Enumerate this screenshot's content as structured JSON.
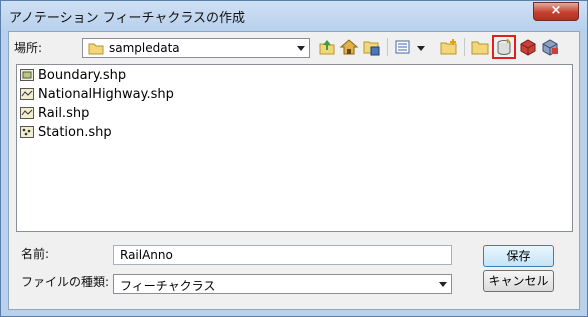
{
  "window": {
    "title": "アノテーション フィーチャクラスの作成",
    "close": "×"
  },
  "location": {
    "label": "場所:",
    "value": "sampledata"
  },
  "toolbar": {
    "icons": [
      "up-folder-icon",
      "home-folder-icon",
      "connect-folder-icon",
      "view-options-icon",
      "new-folder-icon",
      "folder-icon",
      "new-file-geodatabase-icon",
      "new-personal-geodatabase-icon",
      "new-feature-dataset-icon"
    ],
    "highlight_color": "#e0201c"
  },
  "files": [
    {
      "name": "Boundary.shp",
      "icon": "polygon-shapefile-icon"
    },
    {
      "name": "NationalHighway.shp",
      "icon": "line-shapefile-icon"
    },
    {
      "name": "Rail.shp",
      "icon": "line-shapefile-icon"
    },
    {
      "name": "Station.shp",
      "icon": "point-shapefile-icon"
    }
  ],
  "name_field": {
    "label": "名前:",
    "value": "RailAnno"
  },
  "type_field": {
    "label": "ファイルの種類:",
    "value": "フィーチャクラス"
  },
  "buttons": {
    "save": "保存",
    "cancel": "キャンセル"
  }
}
